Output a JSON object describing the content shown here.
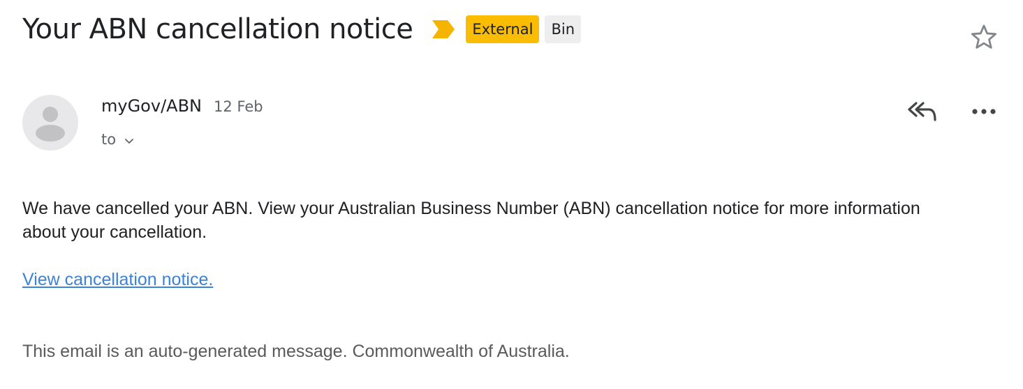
{
  "email": {
    "subject": "Your ABN cancellation notice",
    "labels": {
      "external": "External",
      "bin": "Bin"
    },
    "sender": {
      "name": "myGov/ABN",
      "date": "12 Feb"
    },
    "recipient_label": "to",
    "body": {
      "paragraph": "We have cancelled your ABN. View your Australian Business Number (ABN) cancellation notice for more information about your cancellation.",
      "link_text": "View cancellation notice.",
      "footer": "This email is an auto-generated message. Commonwealth of Australia."
    }
  },
  "icons": {
    "importance": "importance-marker-icon",
    "star": "star-icon",
    "avatar": "avatar-icon",
    "chevron": "chevron-down-icon",
    "reply_all": "reply-all-icon",
    "more": "more-options-icon"
  },
  "colors": {
    "external_label": "#fbbc04",
    "bin_label": "#eeeeee",
    "importance_marker": "#f4b400",
    "link": "#3b82d9",
    "secondary_text": "#5f6368"
  }
}
